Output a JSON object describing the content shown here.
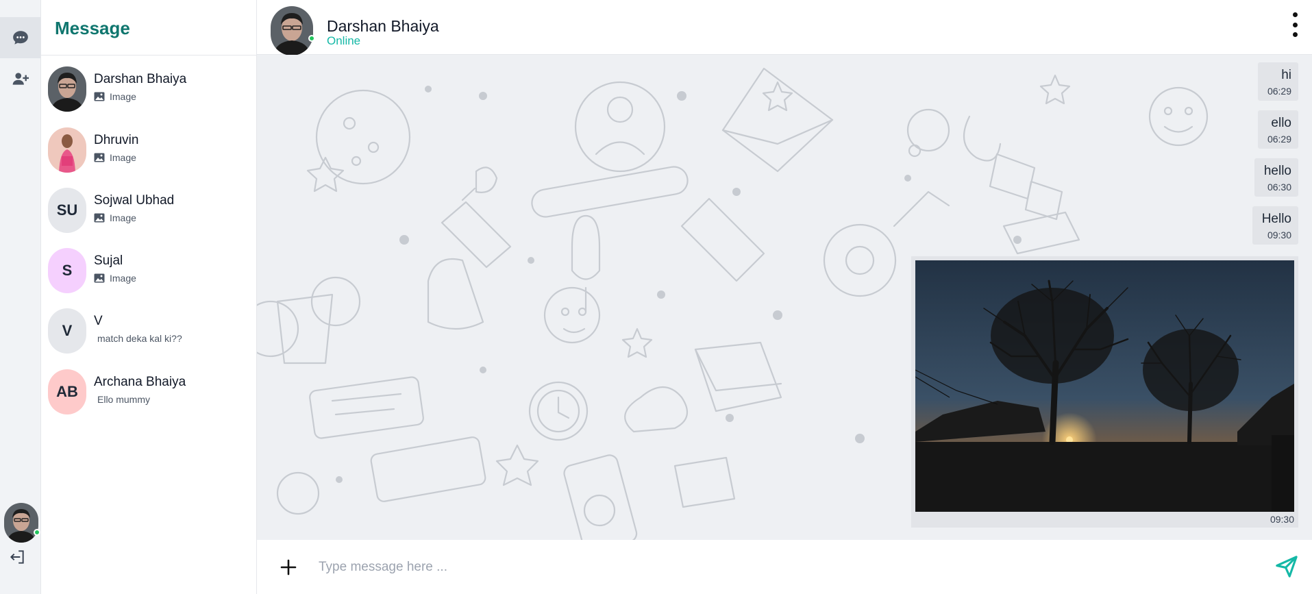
{
  "rail": {
    "items": [
      {
        "icon": "chat-bubble-icon",
        "active": true
      },
      {
        "icon": "add-user-icon",
        "active": false
      }
    ],
    "user_online": true,
    "logout_icon": "logout-icon"
  },
  "sidebar": {
    "title": "Message",
    "contacts": [
      {
        "name": "Darshan Bhaiya",
        "preview": "Image",
        "preview_is_image": true,
        "avatar_type": "photo",
        "initials": ""
      },
      {
        "name": "Dhruvin",
        "preview": "Image",
        "preview_is_image": true,
        "avatar_type": "photo",
        "initials": ""
      },
      {
        "name": "Sojwal Ubhad",
        "preview": "Image",
        "preview_is_image": true,
        "avatar_type": "initials",
        "initials": "SU"
      },
      {
        "name": "Sujal",
        "preview": "Image",
        "preview_is_image": true,
        "avatar_type": "initials",
        "initials": "S"
      },
      {
        "name": "V",
        "preview": "match deka kal ki??",
        "preview_is_image": false,
        "avatar_type": "initials",
        "initials": "V"
      },
      {
        "name": "Archana Bhaiya",
        "preview": "Ello mummy",
        "preview_is_image": false,
        "avatar_type": "initials",
        "initials": "AB"
      }
    ]
  },
  "chat": {
    "contact_name": "Darshan Bhaiya",
    "status": "Online",
    "messages": [
      {
        "type": "text",
        "text": "hi",
        "time": "06:29"
      },
      {
        "type": "text",
        "text": "ello",
        "time": "06:29"
      },
      {
        "type": "text",
        "text": "hello",
        "time": "06:30"
      },
      {
        "type": "text",
        "text": "Hello",
        "time": "09:30"
      },
      {
        "type": "image",
        "text": "",
        "time": "09:30"
      }
    ]
  },
  "composer": {
    "placeholder": "Type message here ...",
    "value": ""
  },
  "colors": {
    "brand": "#0f766e",
    "online": "#22c55e",
    "status_text": "#14b8a6",
    "send": "#14b8a6",
    "avatar_su": "#e5e7eb",
    "avatar_s": "#f5d0fe",
    "avatar_v": "#e5e7eb",
    "avatar_ab": "#fecaca"
  }
}
